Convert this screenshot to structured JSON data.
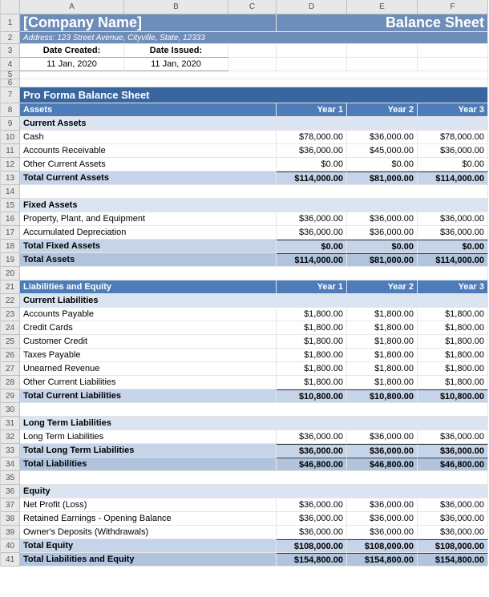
{
  "columns": [
    "A",
    "B",
    "C",
    "D",
    "E",
    "F"
  ],
  "header": {
    "company": "[Company Name]",
    "title": "Balance Sheet",
    "address_label": "Address:",
    "address": "123 Street Avenue, Cityville, State, 12333"
  },
  "dates": {
    "created_label": "Date Created:",
    "created": "11 Jan, 2020",
    "issued_label": "Date Issued:",
    "issued": "11 Jan, 2020"
  },
  "section_title": "Pro Forma Balance Sheet",
  "years": [
    "Year 1",
    "Year 2",
    "Year 3"
  ],
  "assets": {
    "title": "Assets",
    "current": {
      "title": "Current Assets",
      "rows": [
        {
          "label": "Cash",
          "v": [
            "$78,000.00",
            "$36,000.00",
            "$78,000.00"
          ]
        },
        {
          "label": "Accounts Receivable",
          "v": [
            "$36,000.00",
            "$45,000.00",
            "$36,000.00"
          ]
        },
        {
          "label": "Other Current Assets",
          "v": [
            "$0.00",
            "$0.00",
            "$0.00"
          ]
        }
      ],
      "total": {
        "label": "Total Current Assets",
        "v": [
          "$114,000.00",
          "$81,000.00",
          "$114,000.00"
        ]
      }
    },
    "fixed": {
      "title": "Fixed Assets",
      "rows": [
        {
          "label": "Property, Plant, and Equipment",
          "v": [
            "$36,000.00",
            "$36,000.00",
            "$36,000.00"
          ]
        },
        {
          "label": "Accumulated Depreciation",
          "v": [
            "$36,000.00",
            "$36,000.00",
            "$36,000.00"
          ]
        }
      ],
      "total": {
        "label": "Total Fixed Assets",
        "v": [
          "$0.00",
          "$0.00",
          "$0.00"
        ]
      }
    },
    "grand": {
      "label": "Total Assets",
      "v": [
        "$114,000.00",
        "$81,000.00",
        "$114,000.00"
      ]
    }
  },
  "liab": {
    "title": "Liabilities and Equity",
    "current": {
      "title": "Current Liabilities",
      "rows": [
        {
          "label": "Accounts Payable",
          "v": [
            "$1,800.00",
            "$1,800.00",
            "$1,800.00"
          ]
        },
        {
          "label": "Credit Cards",
          "v": [
            "$1,800.00",
            "$1,800.00",
            "$1,800.00"
          ]
        },
        {
          "label": "Customer Credit",
          "v": [
            "$1,800.00",
            "$1,800.00",
            "$1,800.00"
          ]
        },
        {
          "label": "Taxes Payable",
          "v": [
            "$1,800.00",
            "$1,800.00",
            "$1,800.00"
          ]
        },
        {
          "label": "Unearned Revenue",
          "v": [
            "$1,800.00",
            "$1,800.00",
            "$1,800.00"
          ]
        },
        {
          "label": "Other Current Liabilities",
          "v": [
            "$1,800.00",
            "$1,800.00",
            "$1,800.00"
          ]
        }
      ],
      "total": {
        "label": "Total Current Liabilities",
        "v": [
          "$10,800.00",
          "$10,800.00",
          "$10,800.00"
        ]
      }
    },
    "longterm": {
      "title": "Long Term Liabilities",
      "rows": [
        {
          "label": "Long Term Liabilities",
          "v": [
            "$36,000.00",
            "$36,000.00",
            "$36,000.00"
          ]
        }
      ],
      "total": {
        "label": "Total Long Term Liabilities",
        "v": [
          "$36,000.00",
          "$36,000.00",
          "$36,000.00"
        ]
      }
    },
    "grand": {
      "label": "Total Liabilities",
      "v": [
        "$46,800.00",
        "$46,800.00",
        "$46,800.00"
      ]
    }
  },
  "equity": {
    "title": "Equity",
    "rows": [
      {
        "label": "Net Profit (Loss)",
        "v": [
          "$36,000.00",
          "$36,000.00",
          "$36,000.00"
        ]
      },
      {
        "label": "Retained Earnings - Opening Balance",
        "v": [
          "$36,000.00",
          "$36,000.00",
          "$36,000.00"
        ]
      },
      {
        "label": "Owner's Deposits (Withdrawals)",
        "v": [
          "$36,000.00",
          "$36,000.00",
          "$36,000.00"
        ]
      }
    ],
    "total": {
      "label": "Total Equity",
      "v": [
        "$108,000.00",
        "$108,000.00",
        "$108,000.00"
      ]
    }
  },
  "grand_total": {
    "label": "Total Liabilities and Equity",
    "v": [
      "$154,800.00",
      "$154,800.00",
      "$154,800.00"
    ]
  }
}
